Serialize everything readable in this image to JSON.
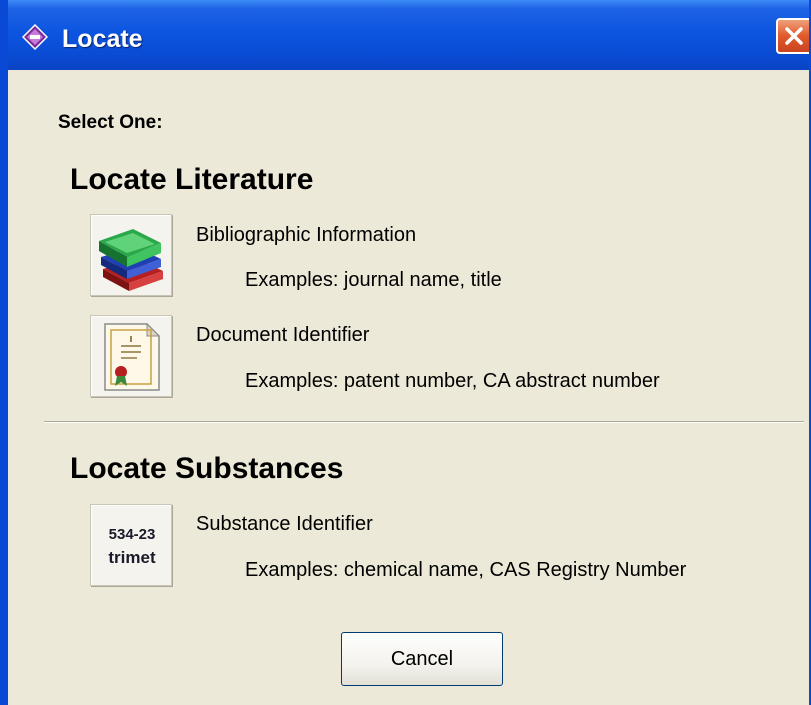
{
  "window": {
    "title": "Locate",
    "app_icon": "cas-diamond-icon",
    "close_icon": "close-icon"
  },
  "prompt": "Select One:",
  "literature": {
    "title": "Locate Literature",
    "options": [
      {
        "label": "Bibliographic Information",
        "example": "Examples: journal name, title",
        "icon": "books-icon"
      },
      {
        "label": "Document Identifier",
        "example": "Examples: patent number, CA abstract number",
        "icon": "certificate-document-icon"
      }
    ]
  },
  "substances": {
    "title": "Locate Substances",
    "options": [
      {
        "label": "Substance Identifier",
        "example": "Examples: chemical name, CAS Registry Number",
        "icon": "substance-id-icon",
        "icon_text": [
          "534-23",
          "trimet"
        ]
      }
    ]
  },
  "buttons": {
    "cancel": "Cancel"
  },
  "colors": {
    "titlebar": "#0a4bd3",
    "dialog_bg": "#ece9d8",
    "close_button": "#e05a2c"
  }
}
